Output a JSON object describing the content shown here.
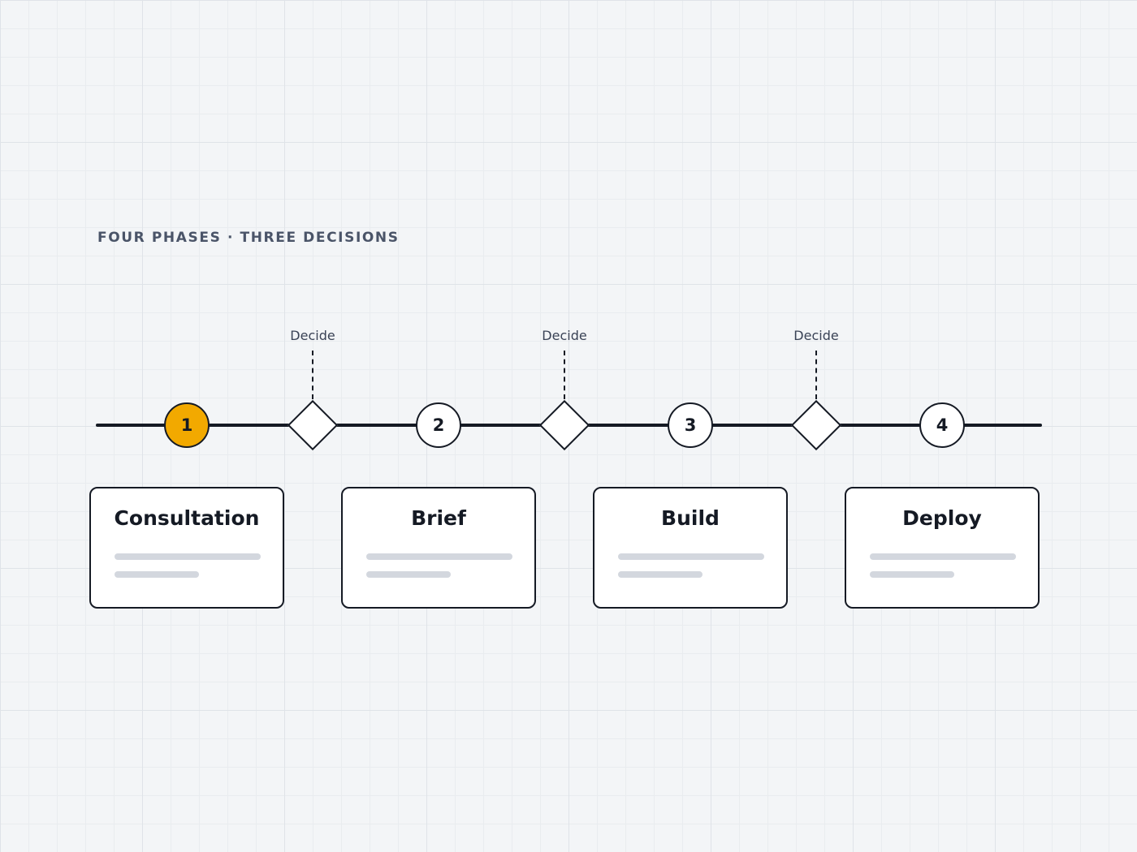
{
  "heading": "FOUR PHASES · THREE DECISIONS",
  "colors": {
    "active": "#f2a900",
    "line": "#151a24",
    "background": "#f3f5f7",
    "placeholder": "#d3d7de"
  },
  "decisions": [
    {
      "label": "Decide"
    },
    {
      "label": "Decide"
    },
    {
      "label": "Decide"
    }
  ],
  "phases": [
    {
      "number": "1",
      "title": "Consultation",
      "active": true
    },
    {
      "number": "2",
      "title": "Brief",
      "active": false
    },
    {
      "number": "3",
      "title": "Build",
      "active": false
    },
    {
      "number": "4",
      "title": "Deploy",
      "active": false
    }
  ]
}
